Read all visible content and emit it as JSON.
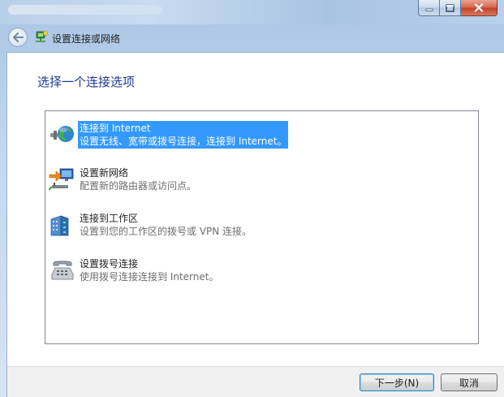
{
  "window": {
    "title": "设置连接或网络",
    "controls": {
      "minimize": "minimize-icon",
      "maximize": "maximize-icon",
      "close": "close-icon"
    }
  },
  "page": {
    "heading": "选择一个连接选项"
  },
  "options": [
    {
      "title": "连接到 Internet",
      "description": "设置无线、宽带或拨号连接，连接到 Internet。",
      "icon": "globe-network-icon",
      "selected": true
    },
    {
      "title": "设置新网络",
      "description": "配置新的路由器或访问点。",
      "icon": "new-network-router-icon",
      "selected": false
    },
    {
      "title": "连接到工作区",
      "description": "设置到您的工作区的拨号或 VPN 连接。",
      "icon": "workplace-building-icon",
      "selected": false
    },
    {
      "title": "设置拨号连接",
      "description": "使用拨号连接连接到 Internet。",
      "icon": "telephone-modem-icon",
      "selected": false
    }
  ],
  "buttons": {
    "next": "下一步(N)",
    "cancel": "取消"
  },
  "colors": {
    "heading": "#1f3a93",
    "selection": "#3399ff",
    "description": "#6d6d6d"
  }
}
